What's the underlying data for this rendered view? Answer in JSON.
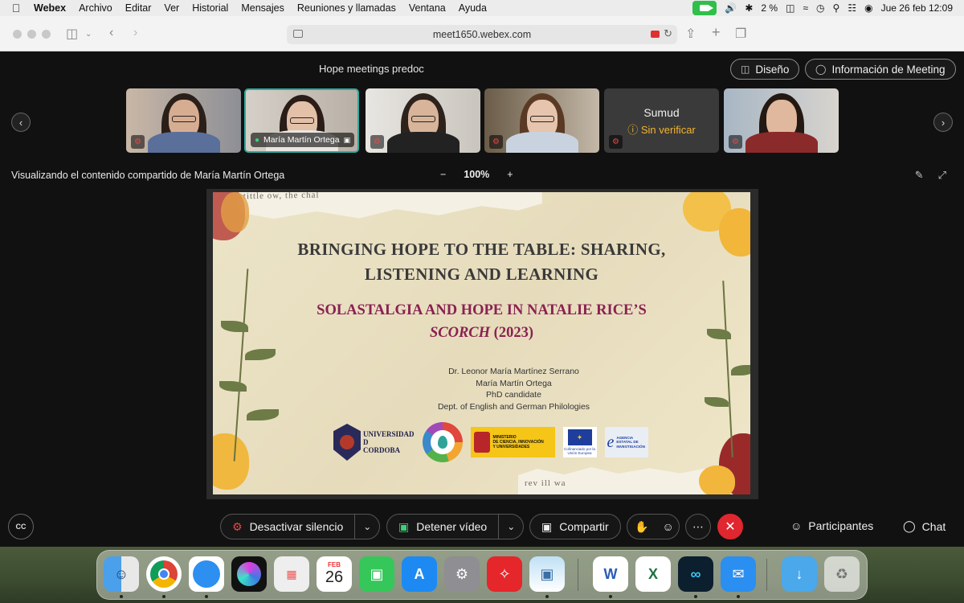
{
  "menubar": {
    "app": "Webex",
    "items": [
      "Archivo",
      "Editar",
      "Ver",
      "Historial",
      "Mensajes",
      "Reuniones y llamadas",
      "Ventana",
      "Ayuda"
    ],
    "battery": "2 %",
    "datetime": "Jue 26 feb 12:09"
  },
  "browser": {
    "url": "meet1650.webex.com"
  },
  "meeting": {
    "title": "Hope meetings predoc",
    "layout_button": "Diseño",
    "info_button": "Información de Meeting",
    "participants": [
      {
        "name": "",
        "muted": true
      },
      {
        "name": "María Martín Ortega",
        "muted": false,
        "active": true
      },
      {
        "name": "",
        "muted": true
      },
      {
        "name": "",
        "muted": true
      },
      {
        "name": "Sumud",
        "status": "Sin verificar",
        "muted": true,
        "video": false
      },
      {
        "name": "",
        "muted": true
      }
    ],
    "sharing_text": "Visualizando el contenido compartido de María Martín Ortega",
    "zoom": {
      "minus": "−",
      "value": "100%",
      "plus": "+"
    }
  },
  "slide": {
    "title_line1": "BRINGING HOPE TO THE TABLE: SHARING,",
    "title_line2": "LISTENING AND LEARNING",
    "subtitle_line1": "SOLASTALGIA AND HOPE IN NATALIE RICE’S",
    "subtitle_italic": "SCORCH",
    "subtitle_year": "(2023)",
    "authors": [
      "Dr. Leonor María Martínez Serrano",
      "María Martín Ortega",
      "PhD candidate",
      "Dept. of English and German Philologies"
    ],
    "paper_top_text": "tittle ow, the chal",
    "paper_bot_text": "rev  ill wa",
    "logos": {
      "uco_line1": "UNIVERSIDAD",
      "uco_line2": "D",
      "uco_line3": "CORDOBA",
      "ministerio_lines": [
        "MINISTERIO",
        "DE CIENCIA, INNOVACIÓN",
        "Y UNIVERSIDADES"
      ],
      "eu_text": "Cofinanciado por la Unión Europea",
      "aei_lines": [
        "AGENCIA",
        "ESTATAL DE",
        "INVESTIGACIÓN"
      ]
    }
  },
  "controls": {
    "cc": "CC",
    "mute": "Desactivar silencio",
    "video": "Detener vídeo",
    "share": "Compartir",
    "participants": "Participantes",
    "chat": "Chat"
  },
  "dock": {
    "calendar_month": "FEB",
    "calendar_day": "26"
  },
  "colors": {
    "accent_teal": "#2fa9a0",
    "end_call_red": "#e0262f",
    "warning_yellow": "#f3b52e",
    "slide_subtitle": "#8a2152"
  }
}
